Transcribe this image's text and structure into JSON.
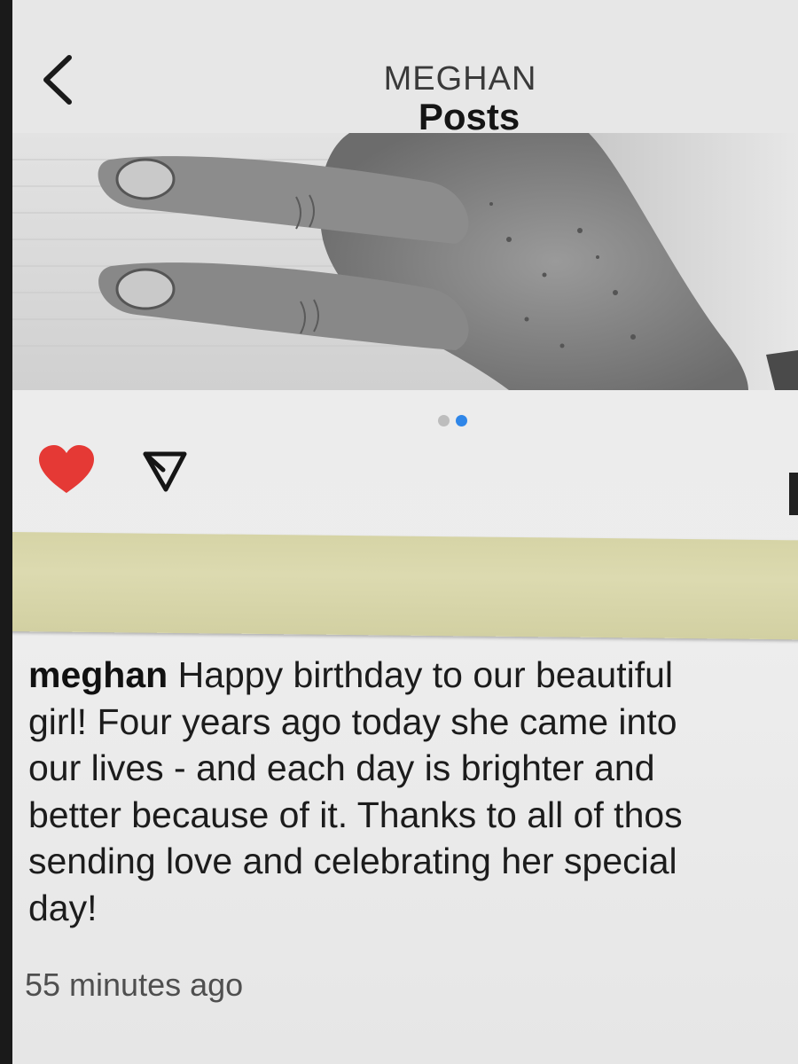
{
  "header": {
    "username": "MEGHAN",
    "title": "Posts",
    "back_icon": "chevron-left-icon"
  },
  "post": {
    "carousel": {
      "total": 2,
      "active": 2,
      "inactive_color": "#bdbdbd",
      "active_color": "#2f86e8"
    },
    "actions": {
      "like_icon": "heart-icon",
      "liked": true,
      "like_color": "#e53935",
      "share_icon": "paper-plane-icon"
    },
    "caption": {
      "username": "meghan",
      "text": " Happy birthday to our beautiful\ngirl! Four years ago today she came into\nour lives - and each day is brighter and\nbetter because of it. Thanks to all of thos\nsending love and celebrating her special\nday!"
    },
    "timestamp": "55 minutes ago"
  },
  "colors": {
    "tape": "#d8d6aa",
    "background": "#ececec"
  }
}
